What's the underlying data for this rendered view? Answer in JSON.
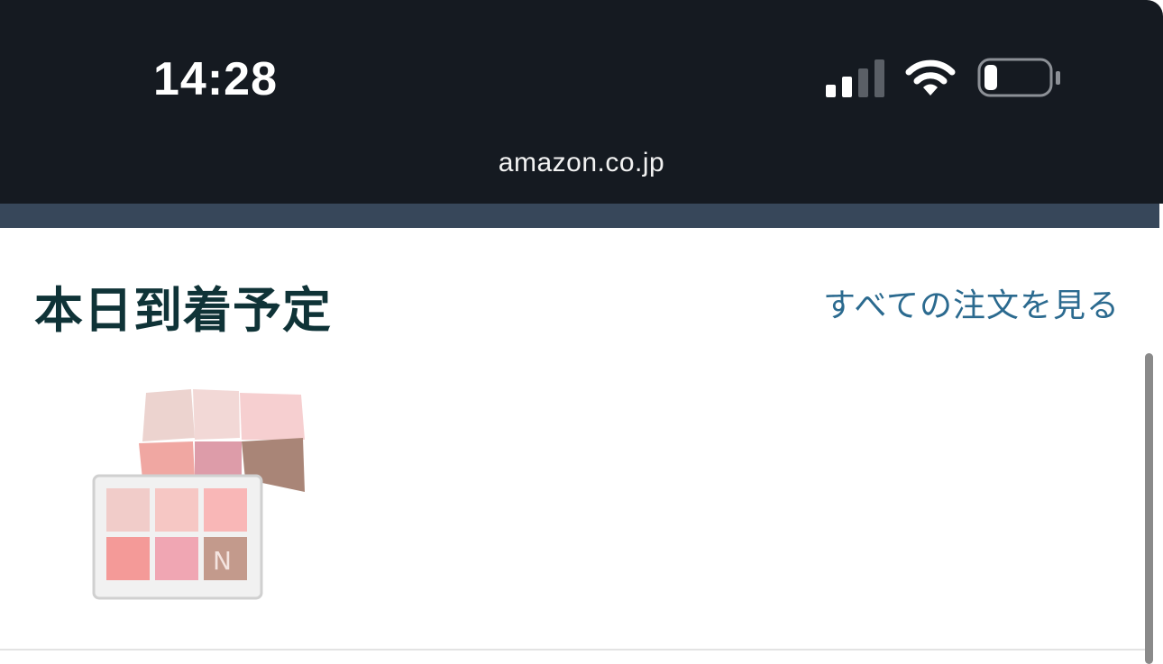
{
  "status_bar": {
    "time": "14:28",
    "icons": [
      "signal-icon",
      "wifi-icon",
      "battery-icon"
    ]
  },
  "browser": {
    "url": "amazon.co.jp"
  },
  "section": {
    "title": "本日到着予定",
    "see_all_label": "すべての注文を見る"
  },
  "product": {
    "image_alt": "eyeshadow palette"
  },
  "colors": {
    "status_bar_bg": "#151a21",
    "nav_strip": "#37475a",
    "title": "#0f3337",
    "link": "#2b6a8f"
  }
}
